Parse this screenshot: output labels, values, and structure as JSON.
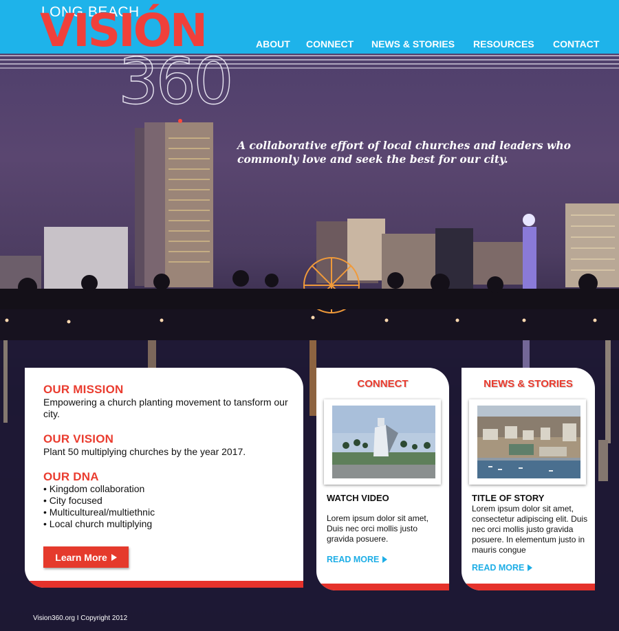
{
  "brand": {
    "top_line": "LONG BEACH",
    "name": "VISIÓN",
    "number": "360",
    "colors": {
      "header_blue": "#1eb3ea",
      "accent_red": "#ea3c2f",
      "link_blue": "#1eaee6"
    }
  },
  "nav": {
    "items": [
      {
        "label": "ABOUT"
      },
      {
        "label": "CONNECT"
      },
      {
        "label": "NEWS & STORIES"
      },
      {
        "label": "RESOURCES"
      },
      {
        "label": "CONTACT"
      }
    ]
  },
  "hero": {
    "tagline_line1": "A collaborative effort of local churches and leaders who",
    "tagline_line2": "commonly love and seek the best for our city."
  },
  "mission_panel": {
    "mission_title": "OUR MISSION",
    "mission_text": "Empowering a church planting movement to tansform our city.",
    "vision_title": "OUR VISION",
    "vision_text": "Plant 50 multiplying churches by the year 2017.",
    "dna_title": "OUR DNA",
    "dna_items": [
      "Kingdom collaboration",
      "City focused",
      "Multicultureal/multiethnic",
      "Local church multiplying"
    ],
    "button_label": "Learn More",
    "button_icon": "triangle-right-icon"
  },
  "connect_card": {
    "title": "CONNECT",
    "subtitle": "WATCH VIDEO",
    "text": "Lorem ipsum dolor sit amet, Duis nec orci mollis justo gravida posuere.",
    "link_label": "READ MORE",
    "link_icon": "triangle-right-icon"
  },
  "news_card": {
    "title": "NEWS & STORIES",
    "subtitle": "TITLE OF STORY",
    "text": "Lorem ipsum dolor sit amet, consectetur adipiscing elit. Duis nec orci mollis justo gravida posuere. In elementum justo in mauris congue",
    "link_label": "READ MORE",
    "link_icon": "triangle-right-icon"
  },
  "footer": {
    "text": "Vision360.org  I  Copyright 2012"
  }
}
